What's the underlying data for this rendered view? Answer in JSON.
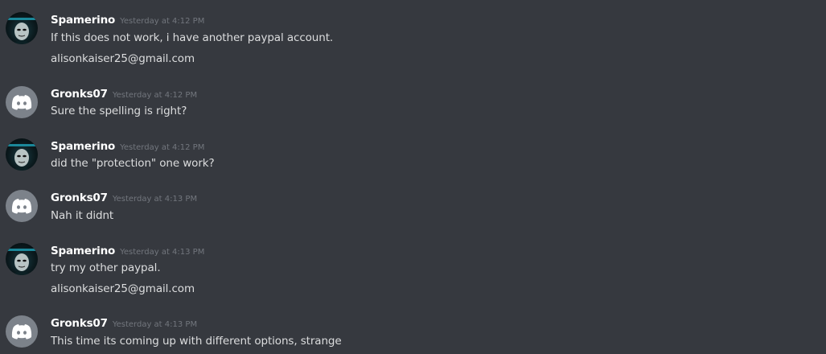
{
  "messages": [
    {
      "username": "Spamerino",
      "timestamp": "Yesterday at 4:12 PM",
      "avatar_icon": "masked-face-avatar",
      "lines": [
        "If this does not work, i have another paypal account.",
        "alisonkaiser25@gmail.com"
      ]
    },
    {
      "username": "Gronks07",
      "timestamp": "Yesterday at 4:12 PM",
      "avatar_icon": "discord-logo-avatar",
      "lines": [
        "Sure the spelling is right?"
      ]
    },
    {
      "username": "Spamerino",
      "timestamp": "Yesterday at 4:12 PM",
      "avatar_icon": "masked-face-avatar",
      "lines": [
        "did the \"protection\" one work?"
      ]
    },
    {
      "username": "Gronks07",
      "timestamp": "Yesterday at 4:13 PM",
      "avatar_icon": "discord-logo-avatar",
      "lines": [
        "Nah it didnt"
      ]
    },
    {
      "username": "Spamerino",
      "timestamp": "Yesterday at 4:13 PM",
      "avatar_icon": "masked-face-avatar",
      "lines": [
        "try my other paypal.",
        "alisonkaiser25@gmail.com"
      ]
    },
    {
      "username": "Gronks07",
      "timestamp": "Yesterday at 4:13 PM",
      "avatar_icon": "discord-logo-avatar",
      "lines": [
        "This time its coming up with different options, strange"
      ]
    }
  ],
  "colors": {
    "background": "#36393f",
    "username": "#ffffff",
    "timestamp": "#72767d",
    "message_text": "#dcddde",
    "default_avatar": "#7c828a"
  }
}
